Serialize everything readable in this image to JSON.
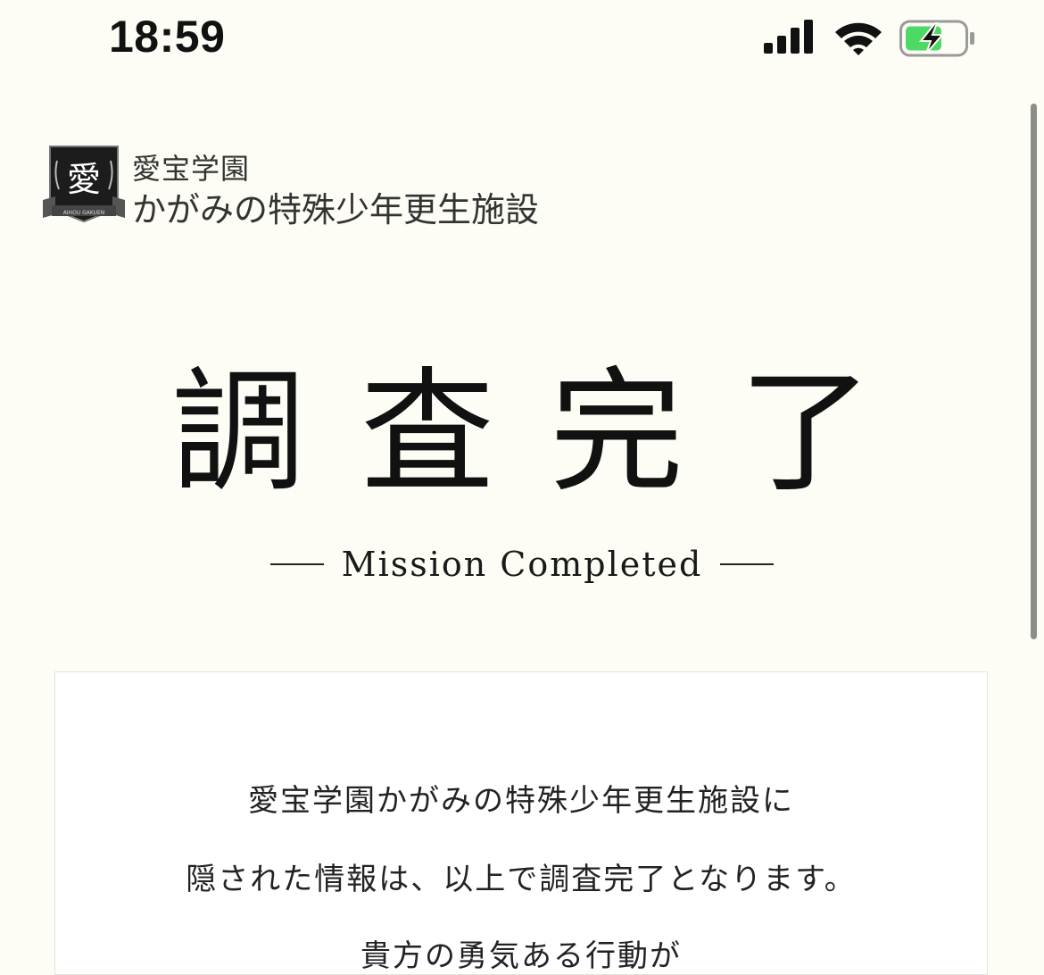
{
  "status_bar": {
    "time": "18:59",
    "icons": [
      "cellular-signal-icon",
      "wifi-icon",
      "battery-charging-icon"
    ],
    "battery_color": "#4cd964"
  },
  "logo": {
    "emblem_char": "愛",
    "emblem_caption": "AIHOU GAKUEN",
    "line_top": "愛宝学園",
    "line_main": "かがみの特殊少年更生施設"
  },
  "heading": {
    "title": "調査完了",
    "subtitle": "Mission Completed"
  },
  "card": {
    "lines": [
      "愛宝学園かがみの特殊少年更生施設に",
      "隠された情報は、以上で調査完了となります。",
      "貴方の勇気ある行動が"
    ]
  },
  "colors": {
    "background": "#fdfdf6",
    "card_background": "#ffffff",
    "text": "#111111",
    "scrollbar": "#8c8c88"
  }
}
